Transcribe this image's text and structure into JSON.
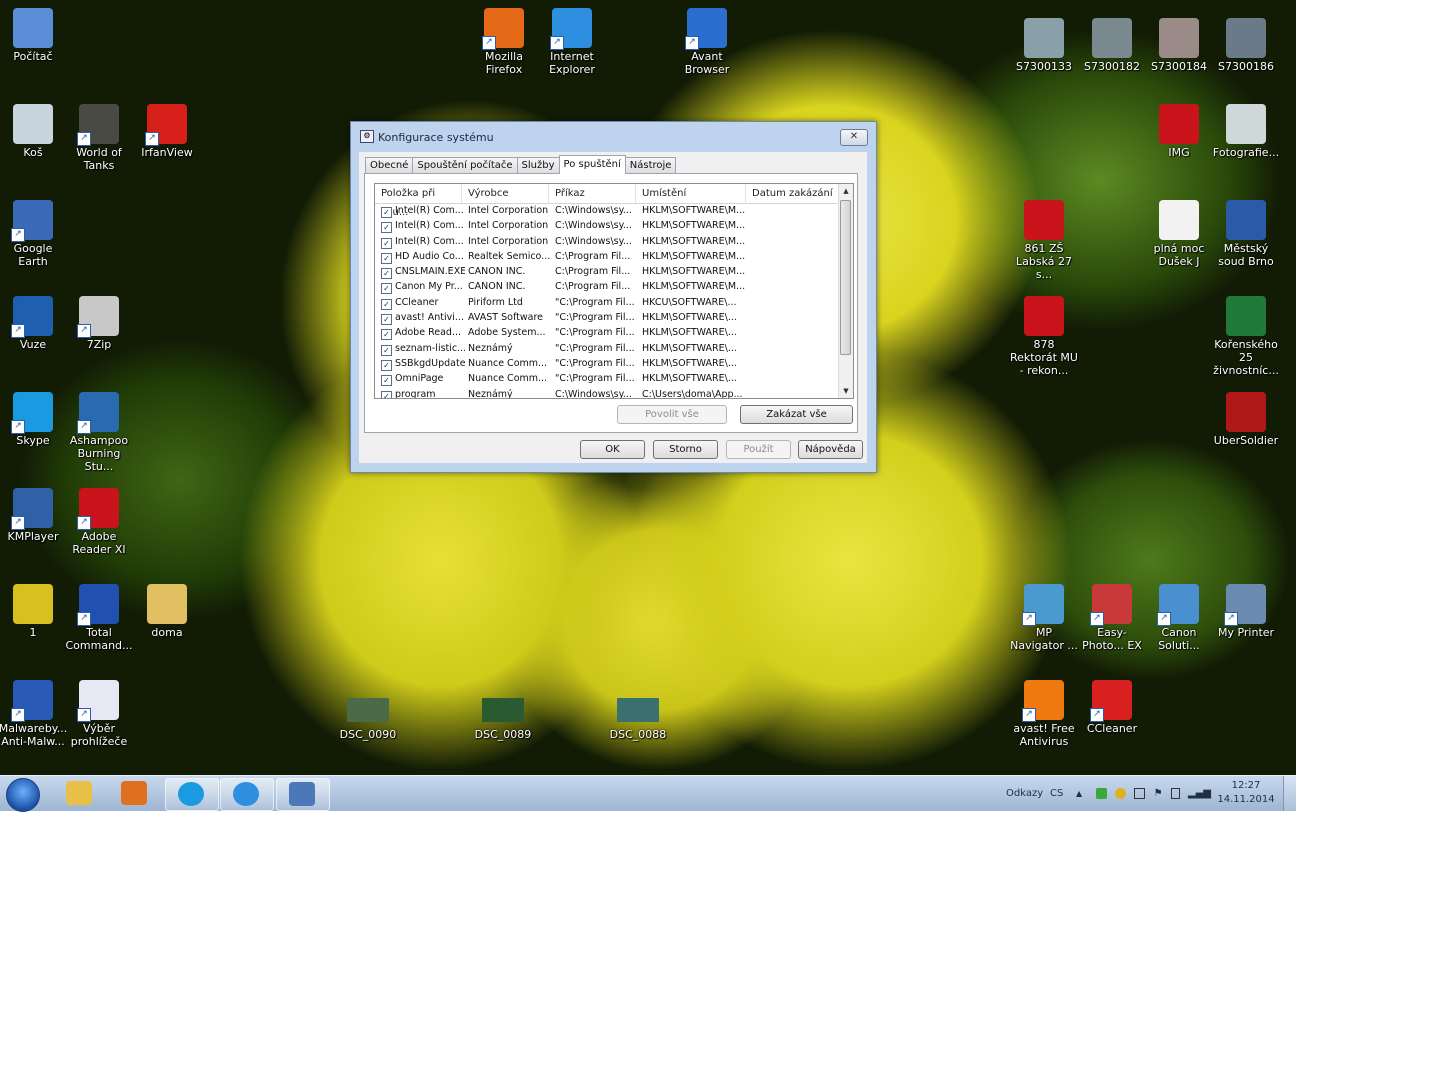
{
  "desktop_icons": [
    {
      "label": "Počítač",
      "icon": "computer-icon",
      "color": "#5a8fd8"
    },
    {
      "label": "Mozilla Firefox",
      "icon": "firefox-icon",
      "color": "#e56a18"
    },
    {
      "label": "Internet Explorer",
      "icon": "ie-icon",
      "color": "#2e8ee0"
    },
    {
      "label": "Avant Browser",
      "icon": "avant-icon",
      "color": "#2a6fd0"
    },
    {
      "label": "S7300133",
      "icon": "scanner-image-icon",
      "color": "#8aa0a8"
    },
    {
      "label": "S7300182",
      "icon": "scanner-image-icon",
      "color": "#7a8890"
    },
    {
      "label": "S7300184",
      "icon": "scanner-image-icon",
      "color": "#9a8a88"
    },
    {
      "label": "S7300186",
      "icon": "scanner-image-icon",
      "color": "#6a7a88"
    },
    {
      "label": "Koš",
      "icon": "recycle-bin-icon",
      "color": "#c8d4de"
    },
    {
      "label": "World of Tanks",
      "icon": "tank-icon",
      "color": "#4a4a44"
    },
    {
      "label": "IrfanView",
      "icon": "irfanview-icon",
      "color": "#d8201a"
    },
    {
      "label": "IMG",
      "icon": "pdf-icon",
      "color": "#c8141a"
    },
    {
      "label": "Fotografie...",
      "icon": "photo-icon",
      "color": "#cfd8d8"
    },
    {
      "label": "Google Earth",
      "icon": "google-earth-icon",
      "color": "#3a6ab8"
    },
    {
      "label": "861 ZŠ Labská 27 s...",
      "icon": "pdf-icon",
      "color": "#c8141a"
    },
    {
      "label": "plná moc Dušek J",
      "icon": "document-icon",
      "color": "#f2f2f2"
    },
    {
      "label": "Městský soud Brno",
      "icon": "word-icon",
      "color": "#2a5aa8"
    },
    {
      "label": "Vuze",
      "icon": "vuze-icon",
      "color": "#1e5fb0"
    },
    {
      "label": "7Zip",
      "icon": "7zip-icon",
      "color": "#c8c8c8"
    },
    {
      "label": "878 Rektorát MU - rekon...",
      "icon": "pdf-icon",
      "color": "#c8141a"
    },
    {
      "label": "Kořenského 25 živnostníc...",
      "icon": "excel-icon",
      "color": "#1f7a3a"
    },
    {
      "label": "Skype",
      "icon": "skype-icon",
      "color": "#1a9ae0"
    },
    {
      "label": "Ashampoo Burning Stu...",
      "icon": "ashampoo-icon",
      "color": "#2a6ab0"
    },
    {
      "label": "UberSoldier",
      "icon": "ubersoldier-icon",
      "color": "#b01818"
    },
    {
      "label": "KMPlayer",
      "icon": "kmplayer-icon",
      "color": "#3060a8"
    },
    {
      "label": "Adobe Reader XI",
      "icon": "adobe-reader-icon",
      "color": "#c8141a"
    },
    {
      "label": "1",
      "icon": "image-icon",
      "color": "#d8c020"
    },
    {
      "label": "Total Command...",
      "icon": "floppy-icon",
      "color": "#2050b0"
    },
    {
      "label": "doma",
      "icon": "folder-user-icon",
      "color": "#e0c060"
    },
    {
      "label": "MP Navigator ...",
      "icon": "mp-navigator-icon",
      "color": "#4a9ad0"
    },
    {
      "label": "Easy-Photo... EX",
      "icon": "easy-photo-icon",
      "color": "#c83a3a"
    },
    {
      "label": "Canon Soluti...",
      "icon": "canon-solution-icon",
      "color": "#4a90d0"
    },
    {
      "label": "My Printer",
      "icon": "printer-icon",
      "color": "#6a8ab0"
    },
    {
      "label": "Malwareby... Anti-Malw...",
      "icon": "malwarebytes-icon",
      "color": "#2a5ab8"
    },
    {
      "label": "Výběr prohlížeče",
      "icon": "checklist-icon",
      "color": "#e8e8f4"
    },
    {
      "label": "DSC_0090",
      "icon": "photo-thumb-icon",
      "color": "#4a6a48"
    },
    {
      "label": "DSC_0089",
      "icon": "photo-thumb-icon",
      "color": "#2a5a30"
    },
    {
      "label": "DSC_0088",
      "icon": "photo-thumb-icon",
      "color": "#3a7070"
    },
    {
      "label": "avast! Free Antivirus",
      "icon": "avast-icon",
      "color": "#f07a10"
    },
    {
      "label": "CCleaner",
      "icon": "ccleaner-icon",
      "color": "#d82020"
    }
  ],
  "dialog": {
    "title": "Konfigurace systému",
    "close_label": "✕",
    "tabs": [
      "Obecné",
      "Spouštění počítače",
      "Služby",
      "Po spuštění",
      "Nástroje"
    ],
    "active_tab": "Po spuštění",
    "columns": [
      "Položka při spu...",
      "Výrobce",
      "Příkaz",
      "Umístění",
      "Datum zakázání"
    ],
    "rows": [
      {
        "checked": true,
        "item": "Intel(R) Com...",
        "vendor": "Intel Corporation",
        "command": "C:\\Windows\\sy...",
        "location": "HKLM\\SOFTWARE\\M...",
        "date": ""
      },
      {
        "checked": true,
        "item": "Intel(R) Com...",
        "vendor": "Intel Corporation",
        "command": "C:\\Windows\\sy...",
        "location": "HKLM\\SOFTWARE\\M...",
        "date": ""
      },
      {
        "checked": true,
        "item": "Intel(R) Com...",
        "vendor": "Intel Corporation",
        "command": "C:\\Windows\\sy...",
        "location": "HKLM\\SOFTWARE\\M...",
        "date": ""
      },
      {
        "checked": true,
        "item": "HD Audio Co...",
        "vendor": "Realtek Semico...",
        "command": "C:\\Program Fil...",
        "location": "HKLM\\SOFTWARE\\M...",
        "date": ""
      },
      {
        "checked": true,
        "item": "CNSLMAIN.EXE",
        "vendor": "CANON INC.",
        "command": "C:\\Program Fil...",
        "location": "HKLM\\SOFTWARE\\M...",
        "date": ""
      },
      {
        "checked": true,
        "item": "Canon My Pr...",
        "vendor": "CANON INC.",
        "command": "C:\\Program Fil...",
        "location": "HKLM\\SOFTWARE\\M...",
        "date": ""
      },
      {
        "checked": true,
        "item": "CCleaner",
        "vendor": "Piriform Ltd",
        "command": "\"C:\\Program Fil...",
        "location": "HKCU\\SOFTWARE\\...",
        "date": ""
      },
      {
        "checked": true,
        "item": "avast! Antivi...",
        "vendor": "AVAST Software",
        "command": "\"C:\\Program Fil...",
        "location": "HKLM\\SOFTWARE\\...",
        "date": ""
      },
      {
        "checked": true,
        "item": "Adobe Read...",
        "vendor": "Adobe System...",
        "command": "\"C:\\Program Fil...",
        "location": "HKLM\\SOFTWARE\\...",
        "date": ""
      },
      {
        "checked": true,
        "item": "seznam-listic...",
        "vendor": "Neznámý",
        "command": "\"C:\\Program Fil...",
        "location": "HKLM\\SOFTWARE\\...",
        "date": ""
      },
      {
        "checked": true,
        "item": "SSBkgdUpdate",
        "vendor": "Nuance Comm...",
        "command": "\"C:\\Program Fil...",
        "location": "HKLM\\SOFTWARE\\...",
        "date": ""
      },
      {
        "checked": true,
        "item": "OmniPage",
        "vendor": "Nuance Comm...",
        "command": "\"C:\\Program Fil...",
        "location": "HKLM\\SOFTWARE\\...",
        "date": ""
      },
      {
        "checked": true,
        "item": "program",
        "vendor": "Neznámý",
        "command": "C:\\Windows\\sy...",
        "location": "C:\\Users\\doma\\App...",
        "date": ""
      }
    ],
    "enable_all": "Povolit vše",
    "disable_all": "Zakázat vše",
    "ok": "OK",
    "cancel": "Storno",
    "apply": "Použít",
    "help": "Nápověda"
  },
  "taskbar": {
    "pinned": [
      {
        "name": "explorer",
        "icon": "folder-icon",
        "color": "#e8c048"
      },
      {
        "name": "media",
        "icon": "media-player-icon",
        "color": "#e07020"
      },
      {
        "name": "skype",
        "icon": "skype-icon",
        "color": "#1a9ae0"
      },
      {
        "name": "ie",
        "icon": "ie-icon",
        "color": "#2e8ee0"
      },
      {
        "name": "msconfig",
        "icon": "msconfig-icon",
        "color": "#4a78b8"
      }
    ],
    "links_label": "Odkazy",
    "language": "CS",
    "clock_time": "12:27",
    "clock_date": "14.11.2014"
  }
}
